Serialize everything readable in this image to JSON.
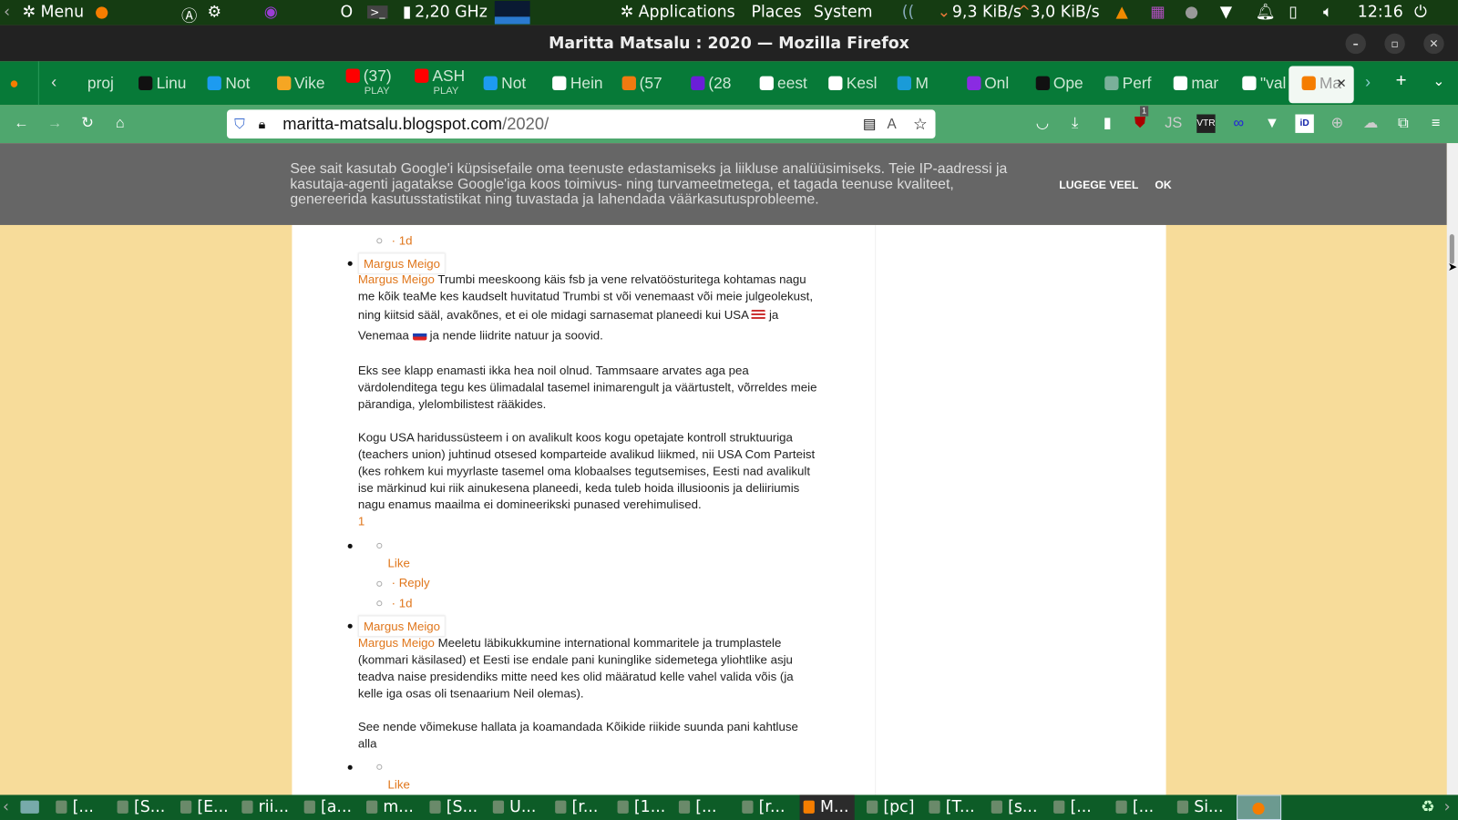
{
  "panel": {
    "menu": "Menu",
    "cpu": "2,20 GHz",
    "applications": "Applications",
    "places": "Places",
    "system": "System",
    "down": "9,3 KiB/s",
    "up": "3,0 KiB/s",
    "clock": "12:16"
  },
  "window": {
    "title": "Maritta Matsalu : 2020 — Mozilla Firefox"
  },
  "tabs": [
    {
      "label": "proj"
    },
    {
      "label": "Linu"
    },
    {
      "label": "Not"
    },
    {
      "label": "Vike"
    },
    {
      "label": "(37)",
      "sub": "PLAY"
    },
    {
      "label": "ASH",
      "sub": "PLAY"
    },
    {
      "label": "Not"
    },
    {
      "label": "Hein"
    },
    {
      "label": "(57"
    },
    {
      "label": "(28"
    },
    {
      "label": "eest"
    },
    {
      "label": "Kesl"
    },
    {
      "label": "M"
    },
    {
      "label": "Onl"
    },
    {
      "label": "Ope"
    },
    {
      "label": "Perf"
    },
    {
      "label": "mar"
    },
    {
      "label": "\"val"
    },
    {
      "label": "Ma",
      "active": true
    }
  ],
  "tab_icon_colors": [
    "#fff0",
    "#111",
    "#1d9bf0",
    "#f5a623",
    "#f00",
    "#f00",
    "#1d9bf0",
    "#fff",
    "#f07a10",
    "#6a1ed8",
    "#fff",
    "#fff",
    "#1a9bd8",
    "#8a2be2",
    "#111",
    "#7ab09a",
    "#fff",
    "#fff",
    "#f57d00"
  ],
  "nav": {
    "url_host": "maritta-matsalu.blogspot.com",
    "url_path": "/2020/",
    "badge": "1"
  },
  "cookie": {
    "lines": [
      "See sait kasutab Google'i küpsisefaile oma teenuste edastamiseks ja liikluse analüüsimiseks. Teie IP-aadressi ja",
      "kasutaja-agenti jagatakse Google'iga koos toimivus- ning turvameetmetega, et tagada teenuse kvaliteet,",
      "genereerida kasutusstatistikat ning tuvastada ja lahendada väärkasutusprobleeme."
    ],
    "more": "LUGEGE VEEL",
    "ok": "OK"
  },
  "comments": {
    "time1": "· 1d",
    "c1": {
      "author": "Margus Meigo",
      "first": "Trumbi meeskoong käis fsb ja vene relvatöösturitega kohtamas nagu",
      "lines": [
        "me kõik teaMe kes kaudselt huvitatud Trumbi st või venemaast või meie julgeolekust,",
        "ning kiitsid sääl, avakõnes, et ei ole midagi sarnasemat planeedi kui USA"
      ],
      "ja": "ja",
      "venemaa": "Venemaa",
      "after": "ja nende liidrite natuur ja soovid.",
      "p2": [
        "Eks see klapp enamasti ikka hea noil olnud. Tammsaare arvates aga pea",
        "värdolenditega tegu kes ülimadalal tasemel inimarengult ja väärtustelt, võrreldes meie",
        "pärandiga, ylelombilistest rääkides."
      ],
      "p3": [
        "Kogu USA haridussüsteem i on avalikult koos kogu opetajate kontroll struktuuriga",
        "(teachers union) juhtinud otsesed komparteide avalikud liikmed, nii USA Com Parteist",
        "(kes rohkem kui myyrlaste tasemel oma klobaalses tegutsemises, Eesti nad avalikult",
        "ise märkinud kui riik ainukesena planeedi, keda tuleb hoida illusioonis ja deliiriumis",
        "nagu enamus maailma ei domineerikski punased verehimulised."
      ],
      "likes": "1",
      "like": "Like",
      "reply": "· Reply",
      "time": "· 1d"
    },
    "c2": {
      "author": "Margus Meigo",
      "first": "Meeletu läbikukkumine international kommaritele ja trumplastele",
      "lines": [
        "(kommari käsilased) et Eesti ise endale pani kuninglike sidemetega yliohtlike asju",
        "teadva naise presidendiks mitte need kes olid määratud kelle vahel valida võis (ja",
        "kelle iga osas oli tsenaarium Neil olemas)."
      ],
      "p2": [
        "See nende võimekuse hallata ja koamandada Kõikide riikide suunda pani kahtluse",
        "alla"
      ],
      "like": "Like"
    }
  },
  "taskbar": [
    {
      "label": "[..."
    },
    {
      "label": "[S..."
    },
    {
      "label": "[E..."
    },
    {
      "label": "rii..."
    },
    {
      "label": "[a..."
    },
    {
      "label": "m..."
    },
    {
      "label": "[S..."
    },
    {
      "label": "U..."
    },
    {
      "label": "[r..."
    },
    {
      "label": "[1..."
    },
    {
      "label": "[..."
    },
    {
      "label": "[r..."
    },
    {
      "label": "M...",
      "active": true
    },
    {
      "label": "[pc]"
    },
    {
      "label": "[T..."
    },
    {
      "label": "[s..."
    },
    {
      "label": "[..."
    },
    {
      "label": "[..."
    },
    {
      "label": "Si..."
    }
  ],
  "colors": {
    "accent": "#e0761b",
    "tabbar": "#077a38",
    "navbar": "#4fa76e",
    "page_bg": "#f7dc9a"
  }
}
